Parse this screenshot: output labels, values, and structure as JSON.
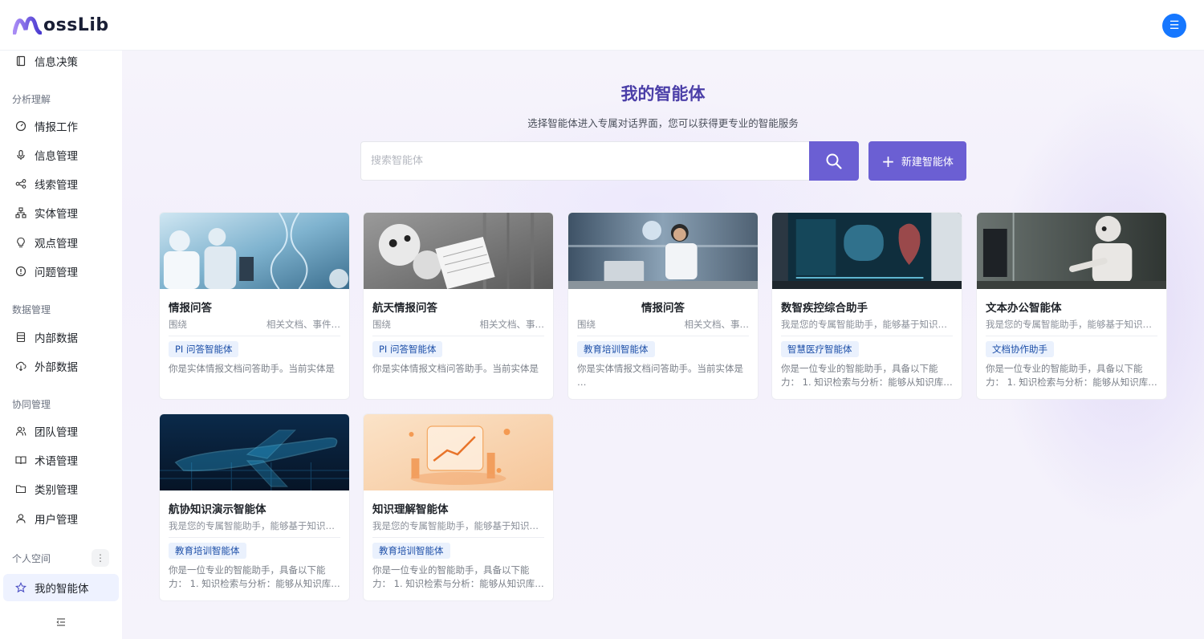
{
  "app": {
    "logo_text": "ossLib",
    "menu_icon": "menu-icon"
  },
  "sidebar": {
    "top_item": {
      "label": "信息决策",
      "icon": "document-icon"
    },
    "sections": [
      {
        "label": "分析理解",
        "items": [
          {
            "label": "情报工作",
            "icon": "dashboard-icon"
          },
          {
            "label": "信息管理",
            "icon": "microphone-icon"
          },
          {
            "label": "线索管理",
            "icon": "share-nodes-icon"
          },
          {
            "label": "实体管理",
            "icon": "hierarchy-icon"
          },
          {
            "label": "观点管理",
            "icon": "bulb-icon"
          },
          {
            "label": "问题管理",
            "icon": "alert-circle-icon"
          }
        ]
      },
      {
        "label": "数据管理",
        "items": [
          {
            "label": "内部数据",
            "icon": "database-icon"
          },
          {
            "label": "外部数据",
            "icon": "cloud-download-icon"
          }
        ]
      },
      {
        "label": "协同管理",
        "items": [
          {
            "label": "团队管理",
            "icon": "team-icon"
          },
          {
            "label": "术语管理",
            "icon": "book-icon"
          },
          {
            "label": "类别管理",
            "icon": "folder-icon"
          },
          {
            "label": "用户管理",
            "icon": "user-icon"
          }
        ]
      },
      {
        "label": "个人空间",
        "items": [
          {
            "label": "我的智能体",
            "icon": "star-icon",
            "active": true
          }
        ]
      }
    ]
  },
  "main": {
    "title": "我的智能体",
    "subtitle": "选择智能体进入专属对话界面，您可以获得更专业的智能服务",
    "search_placeholder": "搜索智能体",
    "create_label": "新建智能体",
    "cards": [
      {
        "title": "情报问答",
        "meta_left": "围绕",
        "meta_right": "相关文档、事件…",
        "tag": "PI 问答智能体",
        "prompt": "你是实体情报文档问答助手。当前实体是",
        "image": "lab-scientists"
      },
      {
        "title": "航天情报问答",
        "meta_left": "围绕",
        "meta_right": "相关文档、事…",
        "tag": "PI 问答智能体",
        "prompt": "你是实体情报文档问答助手。当前实体是",
        "image": "robot-reading"
      },
      {
        "title": "情报问答",
        "meta_left": "围绕",
        "meta_right": "相关文档、事…",
        "tag": "教育培训智能体",
        "prompt": "你是实体情报文档问答助手。当前实体是 …",
        "image": "office-worker"
      },
      {
        "title": "数智疾控综合助手",
        "desc": "我是您的专属智能助手，能够基于知识…",
        "tag": "智慧医疗智能体",
        "prompt": "你是一位专业的智能助手，具备以下能力： 1. 知识检索与分析：能够从知识库…",
        "image": "medical-screen"
      },
      {
        "title": "文本办公智能体",
        "desc": "我是您的专属智能助手，能够基于知识…",
        "tag": "文档协作助手",
        "prompt": "你是一位专业的智能助手，具备以下能力： 1. 知识检索与分析：能够从知识库…",
        "image": "robot-office"
      },
      {
        "title": "航协知识演示智能体",
        "desc": "我是您的专属智能助手，能够基于知识…",
        "tag": "教育培训智能体",
        "prompt": "你是一位专业的智能助手，具备以下能力： 1. 知识检索与分析：能够从知识库…",
        "image": "airplane-wireframe"
      },
      {
        "title": "知识理解智能体",
        "desc": "我是您的专属智能助手，能够基于知识…",
        "tag": "教育培训智能体",
        "prompt": "你是一位专业的智能助手，具备以下能力： 1. 知识检索与分析：能够从知识库…",
        "image": "orange-analytics"
      }
    ]
  },
  "colors": {
    "accent": "#6b5fd3",
    "title": "#4b3fa8",
    "tag_bg": "#eaf1fd",
    "tag_text": "#1d4fa8",
    "menu_btn": "#1677ff"
  }
}
